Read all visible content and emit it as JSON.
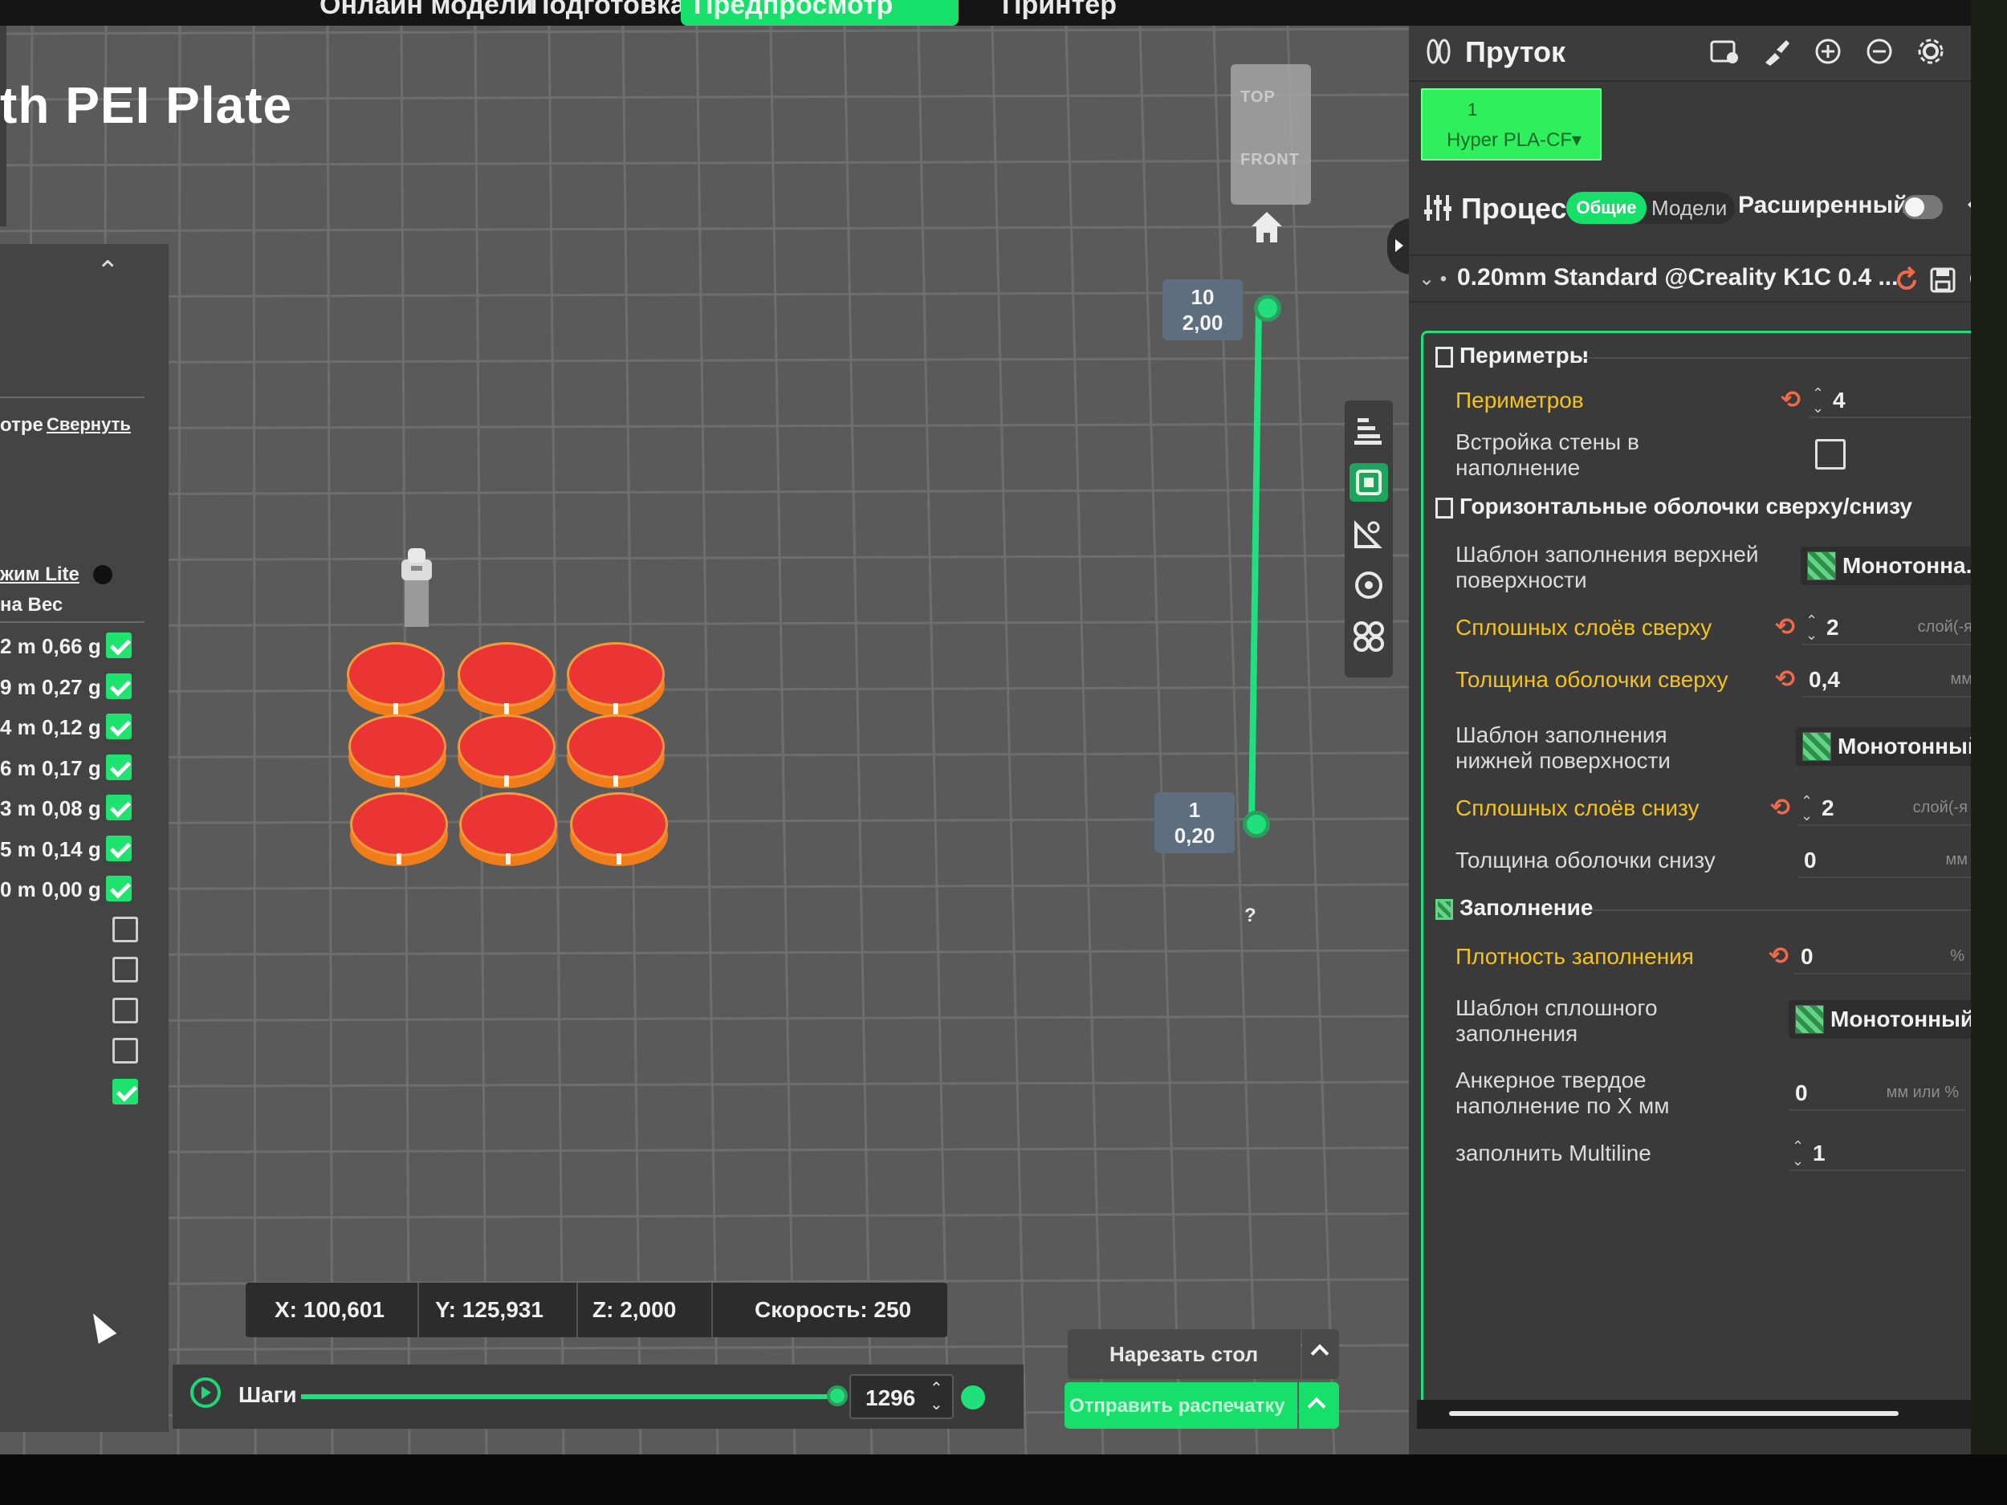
{
  "top_tabs": [
    "Онлайн модели",
    "Подготовка",
    "Предпросмотр",
    "Принтер"
  ],
  "plate_title": "th PEI Plate",
  "view_cube": {
    "top": "TOP",
    "front": "FRONT"
  },
  "layer_slider": {
    "top": {
      "layer": "10",
      "height": "2,00"
    },
    "bottom": {
      "layer": "1",
      "height": "0,20"
    },
    "help": "?"
  },
  "legend": {
    "collapse_label": "Свернуть",
    "view_label": "отре",
    "lite_label": "жим Lite",
    "weight_header": "на Вес",
    "rows": [
      {
        "text": "2 m 0,66 g",
        "checked": true
      },
      {
        "text": "9 m 0,27 g",
        "checked": true
      },
      {
        "text": "4 m 0,12 g",
        "checked": true
      },
      {
        "text": "6 m 0,17 g",
        "checked": true
      },
      {
        "text": "3 m 0,08 g",
        "checked": true
      },
      {
        "text": "5 m 0,14 g",
        "checked": true
      },
      {
        "text": "0 m 0,00 g",
        "checked": true
      },
      {
        "text": "",
        "checked": false
      },
      {
        "text": "",
        "checked": false
      },
      {
        "text": "",
        "checked": false
      },
      {
        "text": "",
        "checked": false
      },
      {
        "text": "",
        "checked": true
      }
    ]
  },
  "coords": {
    "x": "X: 100,601",
    "y": "Y: 125,931",
    "z": "Z: 2,000",
    "speed": "Скорость: 250"
  },
  "steps": {
    "label": "Шаги",
    "value": "1296"
  },
  "buttons": {
    "slice": "Нарезать стол",
    "send": "Отправить распечатку"
  },
  "filament": {
    "title": "Пруток",
    "slot": "1",
    "name": "Hyper PLA-CF",
    "color": "#2ff05c"
  },
  "process": {
    "title": "Процесс",
    "mode_general": "Общие",
    "mode_models": "Модели",
    "advanced": "Расширенный",
    "preset": "0.20mm Standard @Creality K1C 0.4 ..."
  },
  "settings": {
    "walls": {
      "title": "Периметры",
      "wall_loops": {
        "label": "Периметров",
        "value": "4"
      },
      "embed_wall": {
        "label": "Встройка стены в наполнение",
        "checked": false
      }
    },
    "shells": {
      "title": "Горизонтальные оболочки сверху/снизу",
      "top_pattern": {
        "label": "Шаблон заполнения верхней поверхности",
        "value": "Монотонна..."
      },
      "top_layers": {
        "label": "Сплошных слоёв сверху",
        "value": "2",
        "unit": "слой(-я"
      },
      "top_thickness": {
        "label": "Толщина оболочки сверху",
        "value": "0,4",
        "unit": "мм"
      },
      "bottom_pattern": {
        "label": "Шаблон заполнения нижней поверхности",
        "value": "Монотонный"
      },
      "bottom_layers": {
        "label": "Сплошных слоёв снизу",
        "value": "2",
        "unit": "слой(-я"
      },
      "bottom_thickness": {
        "label": "Толщина оболочки снизу",
        "value": "0",
        "unit": "мм"
      }
    },
    "infill": {
      "title": "Заполнение",
      "density": {
        "label": "Плотность заполнения",
        "value": "0",
        "unit": "%"
      },
      "solid_pattern": {
        "label": "Шаблон сплошного заполнения",
        "value": "Монотонный"
      },
      "anchor": {
        "label": "Анкерное твердое наполнение по X мм",
        "value": "0",
        "unit": "мм или %"
      },
      "multiline": {
        "label": "заполнить Multiline",
        "value": "1"
      }
    }
  },
  "colors": {
    "accent": "#16e06a",
    "modified": "#f3c31c",
    "object_top": "#ea3534",
    "object_side": "#f07d1a"
  }
}
